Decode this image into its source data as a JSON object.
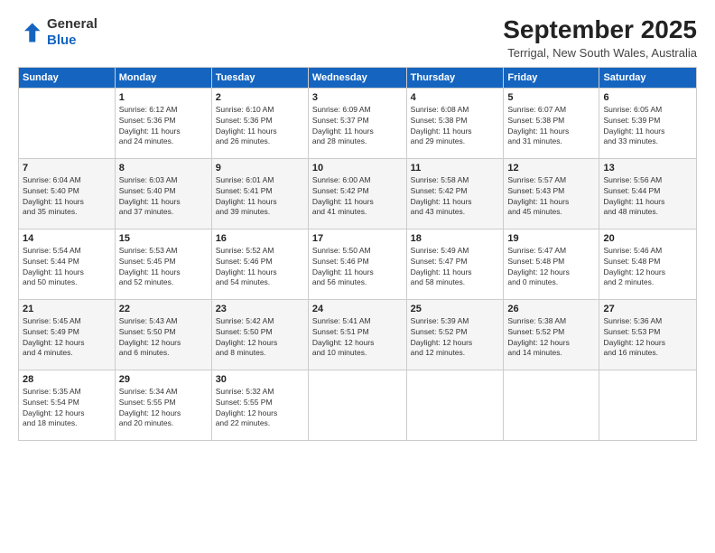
{
  "logo": {
    "line1": "General",
    "line2": "Blue"
  },
  "title": "September 2025",
  "subtitle": "Terrigal, New South Wales, Australia",
  "headers": [
    "Sunday",
    "Monday",
    "Tuesday",
    "Wednesday",
    "Thursday",
    "Friday",
    "Saturday"
  ],
  "weeks": [
    [
      {
        "day": "",
        "info": ""
      },
      {
        "day": "1",
        "info": "Sunrise: 6:12 AM\nSunset: 5:36 PM\nDaylight: 11 hours\nand 24 minutes."
      },
      {
        "day": "2",
        "info": "Sunrise: 6:10 AM\nSunset: 5:36 PM\nDaylight: 11 hours\nand 26 minutes."
      },
      {
        "day": "3",
        "info": "Sunrise: 6:09 AM\nSunset: 5:37 PM\nDaylight: 11 hours\nand 28 minutes."
      },
      {
        "day": "4",
        "info": "Sunrise: 6:08 AM\nSunset: 5:38 PM\nDaylight: 11 hours\nand 29 minutes."
      },
      {
        "day": "5",
        "info": "Sunrise: 6:07 AM\nSunset: 5:38 PM\nDaylight: 11 hours\nand 31 minutes."
      },
      {
        "day": "6",
        "info": "Sunrise: 6:05 AM\nSunset: 5:39 PM\nDaylight: 11 hours\nand 33 minutes."
      }
    ],
    [
      {
        "day": "7",
        "info": "Sunrise: 6:04 AM\nSunset: 5:40 PM\nDaylight: 11 hours\nand 35 minutes."
      },
      {
        "day": "8",
        "info": "Sunrise: 6:03 AM\nSunset: 5:40 PM\nDaylight: 11 hours\nand 37 minutes."
      },
      {
        "day": "9",
        "info": "Sunrise: 6:01 AM\nSunset: 5:41 PM\nDaylight: 11 hours\nand 39 minutes."
      },
      {
        "day": "10",
        "info": "Sunrise: 6:00 AM\nSunset: 5:42 PM\nDaylight: 11 hours\nand 41 minutes."
      },
      {
        "day": "11",
        "info": "Sunrise: 5:58 AM\nSunset: 5:42 PM\nDaylight: 11 hours\nand 43 minutes."
      },
      {
        "day": "12",
        "info": "Sunrise: 5:57 AM\nSunset: 5:43 PM\nDaylight: 11 hours\nand 45 minutes."
      },
      {
        "day": "13",
        "info": "Sunrise: 5:56 AM\nSunset: 5:44 PM\nDaylight: 11 hours\nand 48 minutes."
      }
    ],
    [
      {
        "day": "14",
        "info": "Sunrise: 5:54 AM\nSunset: 5:44 PM\nDaylight: 11 hours\nand 50 minutes."
      },
      {
        "day": "15",
        "info": "Sunrise: 5:53 AM\nSunset: 5:45 PM\nDaylight: 11 hours\nand 52 minutes."
      },
      {
        "day": "16",
        "info": "Sunrise: 5:52 AM\nSunset: 5:46 PM\nDaylight: 11 hours\nand 54 minutes."
      },
      {
        "day": "17",
        "info": "Sunrise: 5:50 AM\nSunset: 5:46 PM\nDaylight: 11 hours\nand 56 minutes."
      },
      {
        "day": "18",
        "info": "Sunrise: 5:49 AM\nSunset: 5:47 PM\nDaylight: 11 hours\nand 58 minutes."
      },
      {
        "day": "19",
        "info": "Sunrise: 5:47 AM\nSunset: 5:48 PM\nDaylight: 12 hours\nand 0 minutes."
      },
      {
        "day": "20",
        "info": "Sunrise: 5:46 AM\nSunset: 5:48 PM\nDaylight: 12 hours\nand 2 minutes."
      }
    ],
    [
      {
        "day": "21",
        "info": "Sunrise: 5:45 AM\nSunset: 5:49 PM\nDaylight: 12 hours\nand 4 minutes."
      },
      {
        "day": "22",
        "info": "Sunrise: 5:43 AM\nSunset: 5:50 PM\nDaylight: 12 hours\nand 6 minutes."
      },
      {
        "day": "23",
        "info": "Sunrise: 5:42 AM\nSunset: 5:50 PM\nDaylight: 12 hours\nand 8 minutes."
      },
      {
        "day": "24",
        "info": "Sunrise: 5:41 AM\nSunset: 5:51 PM\nDaylight: 12 hours\nand 10 minutes."
      },
      {
        "day": "25",
        "info": "Sunrise: 5:39 AM\nSunset: 5:52 PM\nDaylight: 12 hours\nand 12 minutes."
      },
      {
        "day": "26",
        "info": "Sunrise: 5:38 AM\nSunset: 5:52 PM\nDaylight: 12 hours\nand 14 minutes."
      },
      {
        "day": "27",
        "info": "Sunrise: 5:36 AM\nSunset: 5:53 PM\nDaylight: 12 hours\nand 16 minutes."
      }
    ],
    [
      {
        "day": "28",
        "info": "Sunrise: 5:35 AM\nSunset: 5:54 PM\nDaylight: 12 hours\nand 18 minutes."
      },
      {
        "day": "29",
        "info": "Sunrise: 5:34 AM\nSunset: 5:55 PM\nDaylight: 12 hours\nand 20 minutes."
      },
      {
        "day": "30",
        "info": "Sunrise: 5:32 AM\nSunset: 5:55 PM\nDaylight: 12 hours\nand 22 minutes."
      },
      {
        "day": "",
        "info": ""
      },
      {
        "day": "",
        "info": ""
      },
      {
        "day": "",
        "info": ""
      },
      {
        "day": "",
        "info": ""
      }
    ]
  ]
}
